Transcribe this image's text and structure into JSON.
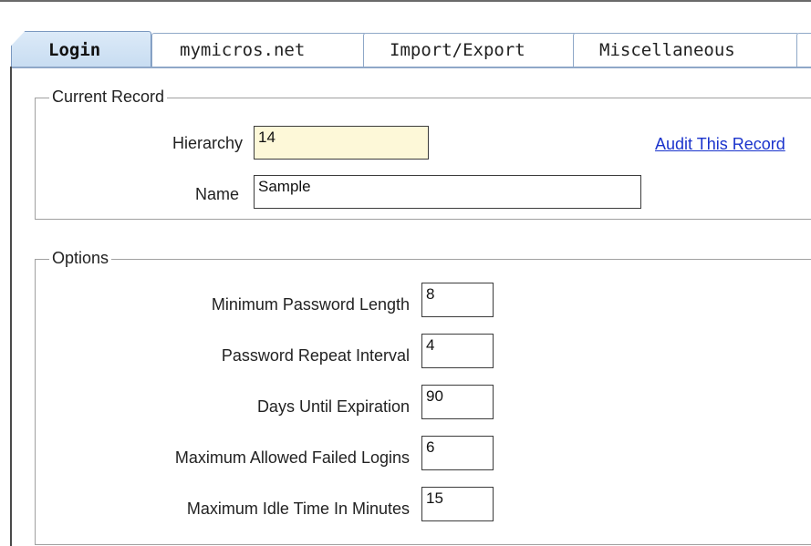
{
  "tabs": [
    {
      "label": "Login",
      "active": true
    },
    {
      "label": "mymicros.net",
      "active": false
    },
    {
      "label": "Import/Export",
      "active": false
    },
    {
      "label": "Miscellaneous",
      "active": false
    }
  ],
  "current_record": {
    "legend": "Current Record",
    "hierarchy_label": "Hierarchy",
    "hierarchy_value": "14",
    "name_label": "Name",
    "name_value": "Sample",
    "audit_link": "Audit This Record"
  },
  "options": {
    "legend": "Options",
    "fields": [
      {
        "label": "Minimum Password Length",
        "value": "8"
      },
      {
        "label": "Password Repeat Interval",
        "value": "4"
      },
      {
        "label": "Days Until Expiration",
        "value": "90"
      },
      {
        "label": "Maximum Allowed Failed Logins",
        "value": "6"
      },
      {
        "label": "Maximum Idle Time In Minutes",
        "value": "15"
      }
    ]
  },
  "colors": {
    "hierarchy_field_bg": "#fdf8d8",
    "link": "#1a33cc",
    "active_tab": "#c7dcf1"
  }
}
